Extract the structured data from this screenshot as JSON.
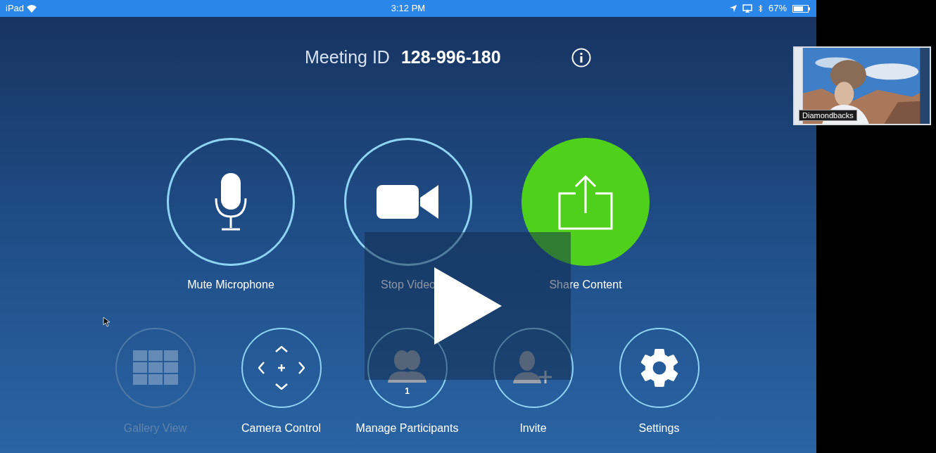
{
  "status_bar": {
    "device": "iPad",
    "time": "3:12 PM",
    "battery": "67%"
  },
  "meeting": {
    "label": "Meeting ID",
    "id": "128-996-180"
  },
  "main_controls": [
    {
      "label": "Mute Microphone",
      "kind": "outline",
      "disabled": false
    },
    {
      "label": "Stop Video",
      "kind": "outline",
      "disabled": false
    },
    {
      "label": "Share Content",
      "kind": "filled",
      "disabled": false
    }
  ],
  "secondary_controls": [
    {
      "label": "Gallery View",
      "disabled": true
    },
    {
      "label": "Camera Control",
      "disabled": false
    },
    {
      "label": "Manage Participants",
      "disabled": false,
      "count": "1"
    },
    {
      "label": "Invite",
      "disabled": false
    },
    {
      "label": "Settings",
      "disabled": false
    }
  ],
  "video_thumbnail": {
    "name": "Diamondbacks"
  }
}
